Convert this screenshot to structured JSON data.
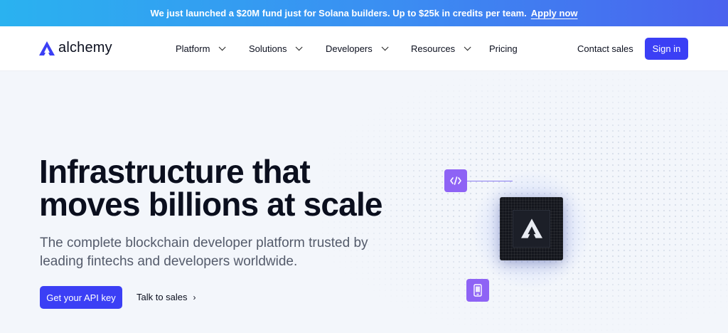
{
  "banner": {
    "text": "We just launched a $20M fund just for Solana builders. Up to $25k in credits per team.",
    "link_label": "Apply now",
    "gradient": [
      "#2ab2f0",
      "#4a62ee"
    ]
  },
  "nav": {
    "logo_text": "alchemy",
    "items": [
      {
        "label": "Platform",
        "has_dropdown": true
      },
      {
        "label": "Solutions",
        "has_dropdown": true
      },
      {
        "label": "Developers",
        "has_dropdown": true
      },
      {
        "label": "Resources",
        "has_dropdown": true
      },
      {
        "label": "Pricing",
        "has_dropdown": false
      }
    ],
    "contact_label": "Contact sales",
    "signin_label": "Sign in"
  },
  "hero": {
    "headline_line1": "Infrastructure that",
    "headline_line2": "moves billions at scale",
    "subtitle_line1": "The complete blockchain developer platform trusted by",
    "subtitle_line2": "leading fintechs and developers worldwide.",
    "primary_cta": "Get your API key",
    "secondary_cta": "Talk to sales",
    "secondary_cta_icon": "chevron-right-icon",
    "illustration": {
      "tiles": [
        "code-icon",
        "mobile-phone-icon"
      ],
      "chip_icon": "alchemy-logo-icon"
    }
  },
  "colors": {
    "accent": "#3b3ff5",
    "tile": "#8e63f5",
    "chip": "#14161d",
    "background": "#f3f6fb"
  }
}
